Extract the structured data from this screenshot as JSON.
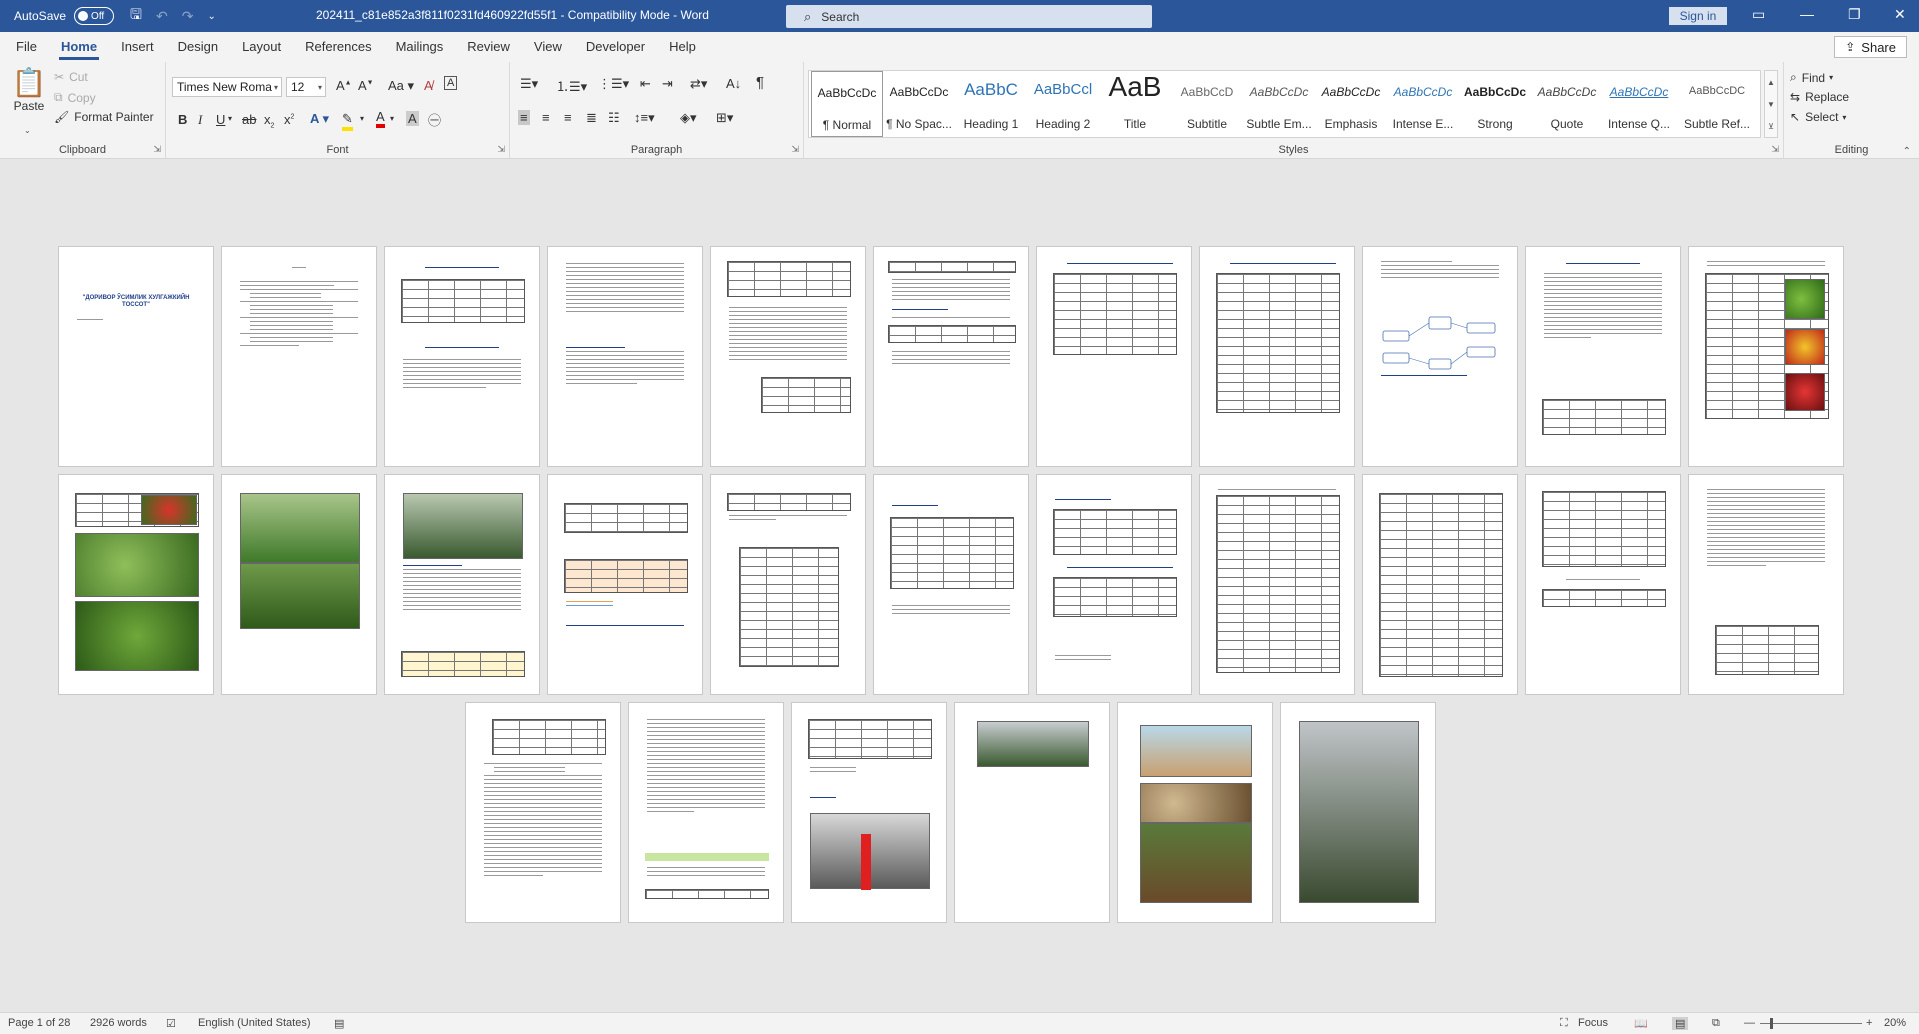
{
  "titlebar": {
    "autosave_label": "AutoSave",
    "autosave_state": "Off",
    "doc_title": "202411_c81e852a3f811f0231fd460922fd55f1  -  Compatibility Mode  -  Word",
    "search_placeholder": "Search",
    "signin_label": "Sign in"
  },
  "tabs": [
    "File",
    "Home",
    "Insert",
    "Design",
    "Layout",
    "References",
    "Mailings",
    "Review",
    "View",
    "Developer",
    "Help"
  ],
  "active_tab": "Home",
  "share_label": "Share",
  "ribbon": {
    "clipboard": {
      "label": "Clipboard",
      "paste": "Paste",
      "cut": "Cut",
      "copy": "Copy",
      "format_painter": "Format Painter"
    },
    "font": {
      "label": "Font",
      "font_name": "Times New Roma",
      "font_size": "12"
    },
    "paragraph": {
      "label": "Paragraph"
    },
    "styles": {
      "label": "Styles",
      "items": [
        {
          "preview": "AaBbCcDc",
          "name": "¶ Normal"
        },
        {
          "preview": "AaBbCcDc",
          "name": "¶ No Spac..."
        },
        {
          "preview": "AaBbC",
          "name": "Heading 1"
        },
        {
          "preview": "AaBbCcl",
          "name": "Heading 2"
        },
        {
          "preview": "AaB",
          "name": "Title"
        },
        {
          "preview": "AaBbCcD",
          "name": "Subtitle"
        },
        {
          "preview": "AaBbCcDc",
          "name": "Subtle Em..."
        },
        {
          "preview": "AaBbCcDc",
          "name": "Emphasis"
        },
        {
          "preview": "AaBbCcDc",
          "name": "Intense E..."
        },
        {
          "preview": "AaBbCcDc",
          "name": "Strong"
        },
        {
          "preview": "AaBbCcDc",
          "name": "Quote"
        },
        {
          "preview": "AaBbCcDc",
          "name": "Intense Q..."
        },
        {
          "preview": "AaBbCcDC",
          "name": "Subtle Ref..."
        }
      ]
    },
    "editing": {
      "label": "Editing",
      "find": "Find",
      "replace": "Replace",
      "select": "Select"
    }
  },
  "document": {
    "cover_title": "\"ДОРИВОР ЎСИМЛИК ХУЛГАЖКИЙН ТОССОТ\"",
    "page_count": 28
  },
  "statusbar": {
    "page": "Page 1 of 28",
    "words": "2926 words",
    "language": "English (United States)",
    "focus": "Focus",
    "zoom": "20%"
  }
}
